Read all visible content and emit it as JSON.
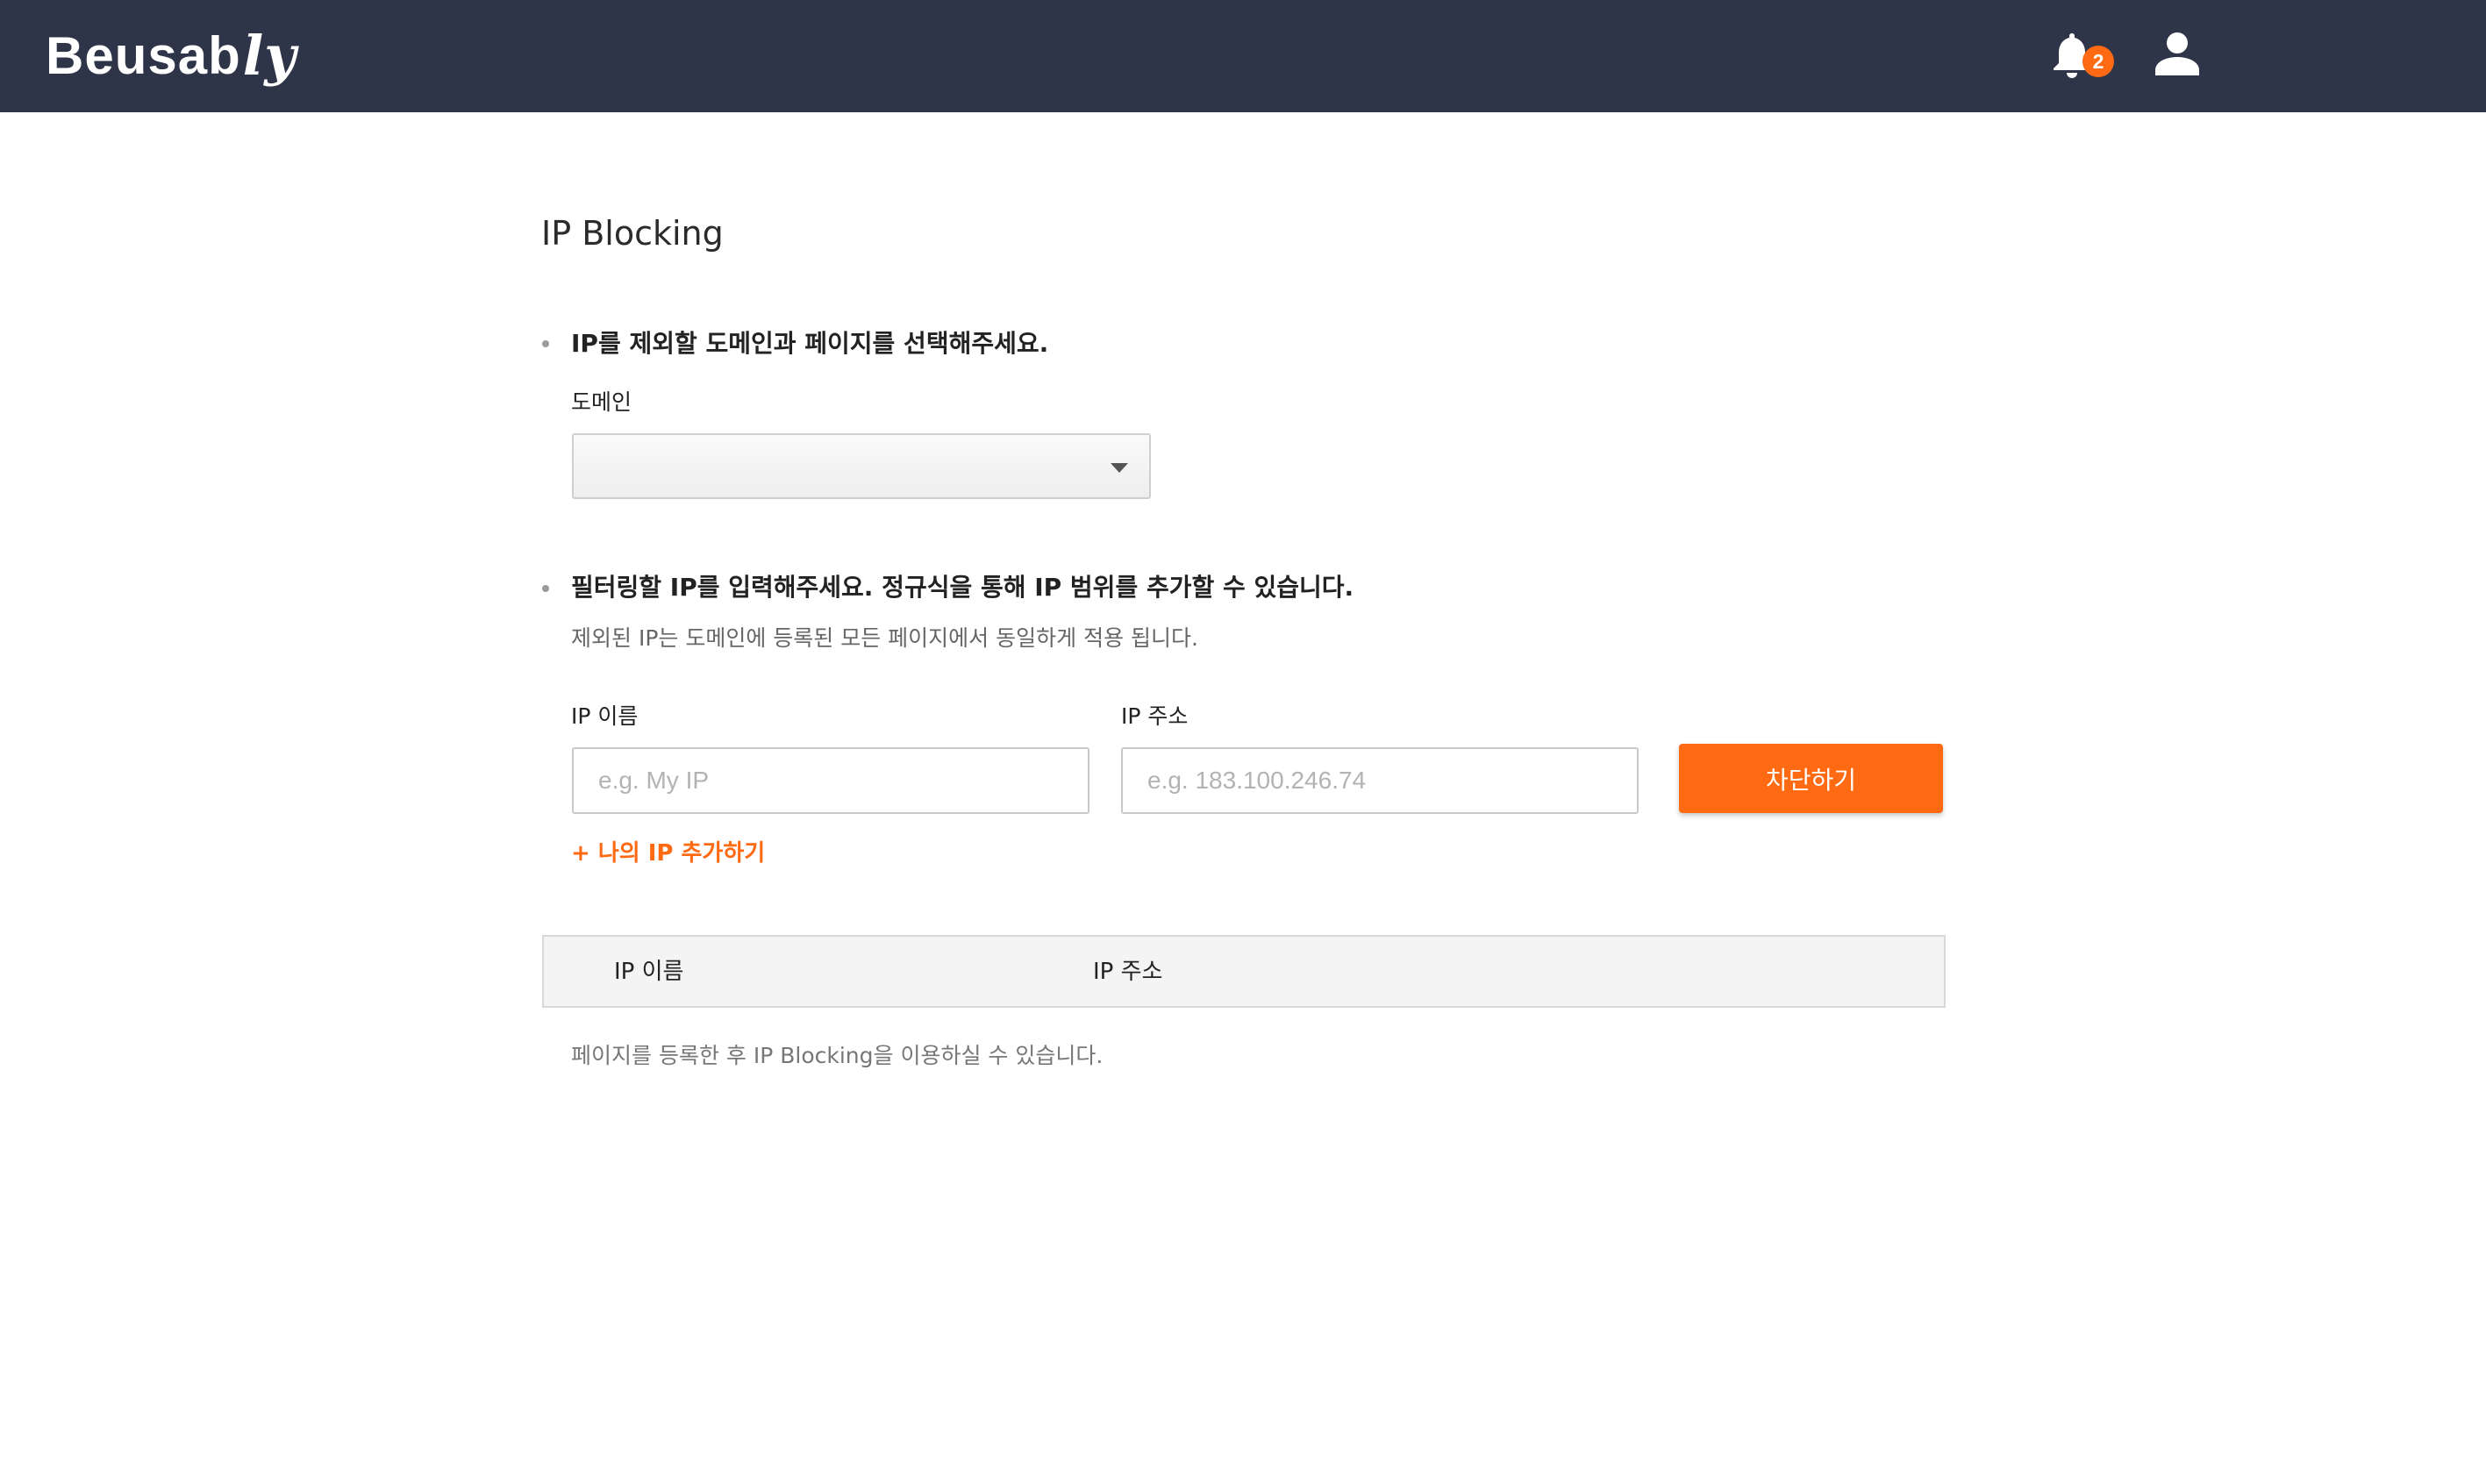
{
  "header": {
    "logo_main": "Beusab",
    "logo_tail": "ly",
    "notification_count": "2",
    "icons": [
      "bell-icon",
      "user-icon"
    ],
    "background_color": "#2e3548",
    "accent_color": "#ff6a13"
  },
  "page": {
    "title": "IP Blocking"
  },
  "domain_section": {
    "heading": "IP를 제외할 도메인과 페이지를 선택해주세요.",
    "label": "도메인",
    "selected_value": ""
  },
  "ip_section": {
    "heading": "필터링할 IP를 입력해주세요. 정규식을 통해 IP 범위를 추가할 수 있습니다.",
    "subtext": "제외된 IP는 도메인에 등록된 모든 페이지에서 동일하게 적용 됩니다.",
    "ip_name_label": "IP 이름",
    "ip_name_placeholder": "e.g. My IP",
    "ip_name_value": "",
    "ip_address_label": "IP 주소",
    "ip_address_placeholder": "e.g. 183.100.246.74",
    "ip_address_value": "",
    "block_button_label": "차단하기",
    "add_my_ip_label": "+ 나의 IP 추가하기"
  },
  "table": {
    "columns": [
      "IP 이름",
      "IP 주소"
    ],
    "rows": [],
    "empty_message": "페이지를 등록한 후 IP Blocking을 이용하실 수 있습니다."
  }
}
